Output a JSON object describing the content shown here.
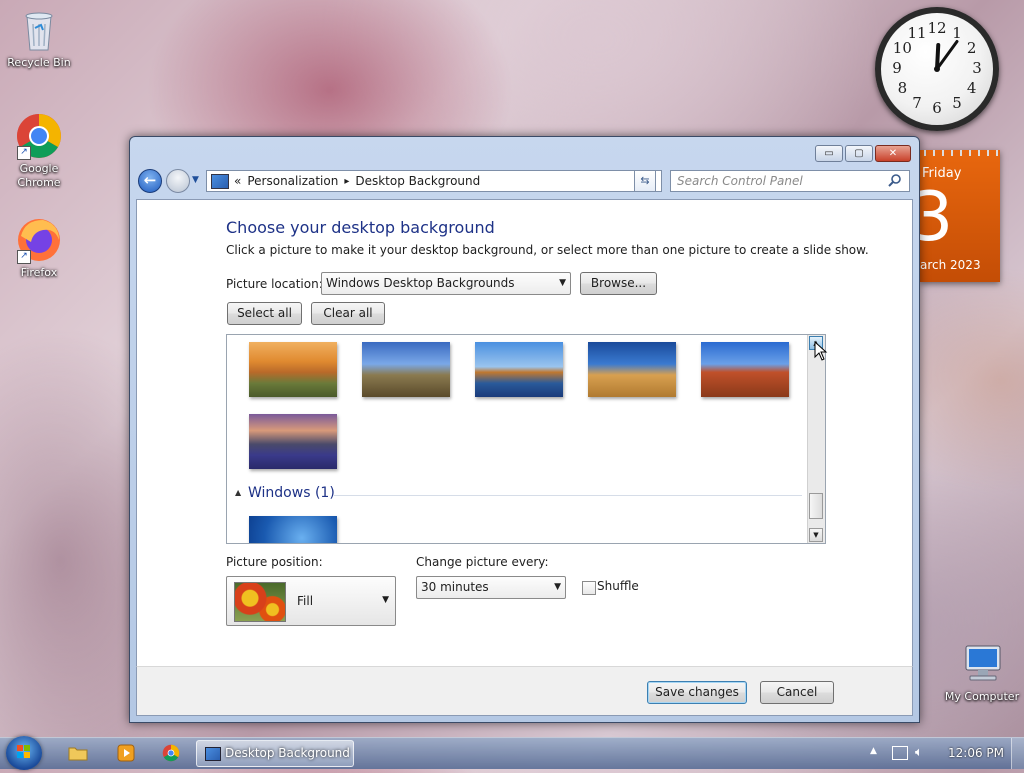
{
  "desktop": {
    "icons": [
      {
        "label": "Recycle Bin"
      },
      {
        "label": "Google Chrome"
      },
      {
        "label": "Firefox"
      },
      {
        "label": "My Computer"
      }
    ]
  },
  "gadgets": {
    "clock": {
      "numbers": [
        "12",
        "1",
        "2",
        "3",
        "4",
        "5",
        "6",
        "7",
        "8",
        "9",
        "10",
        "11"
      ],
      "hour": 12,
      "minute": 6
    },
    "calendar": {
      "weekday": "Friday",
      "day": "3",
      "month_year": "arch 2023"
    }
  },
  "window": {
    "caption_buttons": {
      "minimize": "▭",
      "maximize": "▢",
      "close": "✕"
    },
    "breadcrumb": {
      "overflow": "«",
      "items": [
        "Personalization",
        "Desktop Background"
      ],
      "separator": "▸"
    },
    "search_placeholder": "Search Control Panel",
    "heading": "Choose your desktop background",
    "instruction": "Click a picture to make it your desktop background, or select more than one picture to create a slide show.",
    "picture_location": {
      "label": "Picture location:",
      "value": "Windows Desktop Backgrounds"
    },
    "browse_label": "Browse...",
    "select_all_label": "Select all",
    "clear_all_label": "Clear all",
    "group_windows": {
      "label": "Windows (1)"
    },
    "picture_position": {
      "label": "Picture position:",
      "value": "Fill"
    },
    "change_picture": {
      "label": "Change picture every:",
      "value": "30 minutes"
    },
    "shuffle": {
      "label": "Shuffle",
      "checked": false
    },
    "save_label": "Save changes",
    "cancel_label": "Cancel"
  },
  "taskbar": {
    "active_window": "Desktop Background",
    "time": "12:06 PM"
  },
  "colors": {
    "heading": "#1e3287",
    "group_header": "#1e3287",
    "calendar": "#d9580a"
  }
}
